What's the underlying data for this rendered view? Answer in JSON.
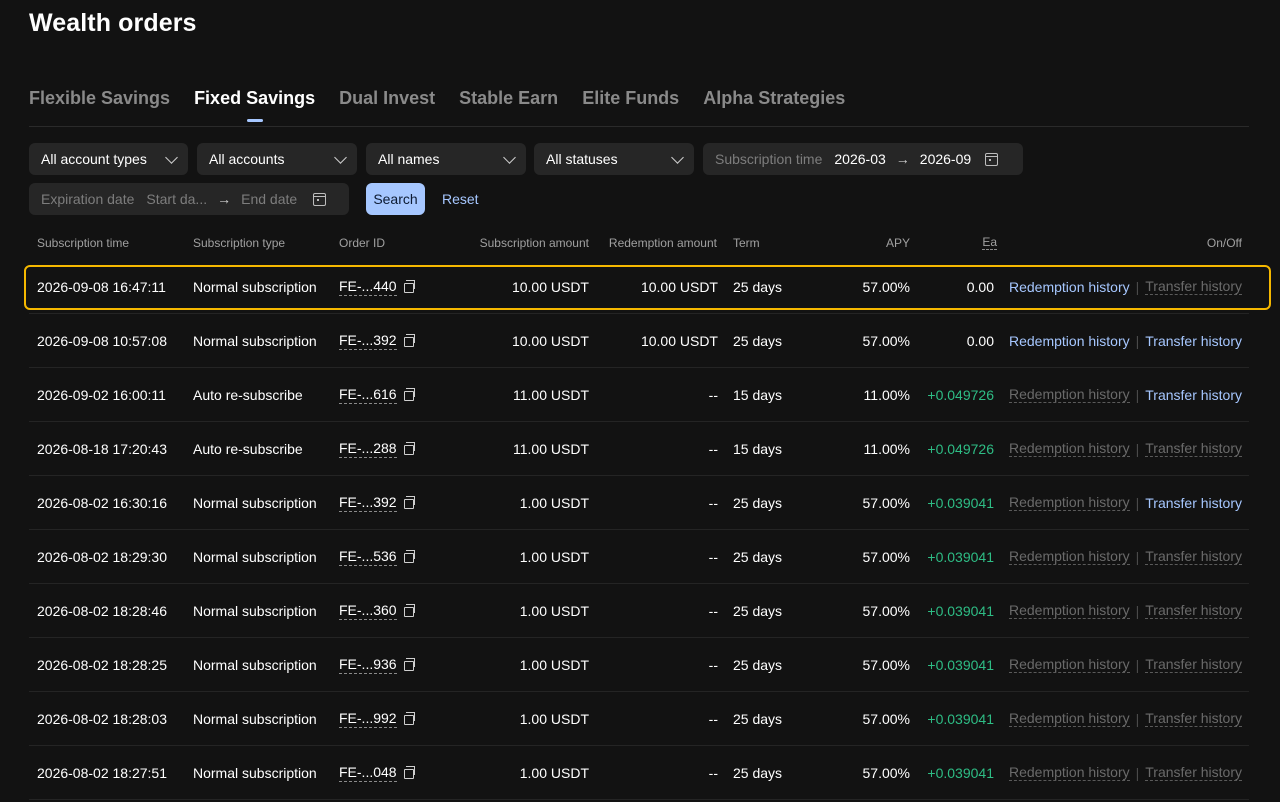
{
  "page": {
    "title": "Wealth orders"
  },
  "tabs": [
    "Flexible Savings",
    "Fixed Savings",
    "Dual Invest",
    "Stable Earn",
    "Elite Funds",
    "Alpha Strategies"
  ],
  "active_tab": "Fixed Savings",
  "filters": {
    "account_types": "All account types",
    "accounts": "All accounts",
    "names": "All names",
    "statuses": "All statuses",
    "subscription_time": {
      "label": "Subscription time",
      "start": "2026-03",
      "end": "2026-09"
    },
    "expiration_date": {
      "label": "Expiration date",
      "start_placeholder": "Start da...",
      "end_placeholder": "End date"
    },
    "search_label": "Search",
    "reset_label": "Reset"
  },
  "table": {
    "headers": {
      "subscription_time": "Subscription time",
      "subscription_type": "Subscription type",
      "order_id": "Order ID",
      "subscription_amount": "Subscription amount",
      "redemption_amount": "Redemption amount",
      "term": "Term",
      "apy": "APY",
      "earnings": "Ea",
      "on_off": "On/Off"
    },
    "rows": [
      {
        "time": "2026-09-08 16:47:11",
        "type": "Normal subscription",
        "order_id": "FE-...440",
        "sub_amount": "10.00 USDT",
        "red_amount": "10.00 USDT",
        "term": "25 days",
        "apy": "57.00%",
        "earnings": "0.00",
        "earnings_positive": false,
        "redemption_history": "Redemption history",
        "redemption_active": true,
        "transfer_history": "Transfer history",
        "transfer_active": false
      },
      {
        "time": "2026-09-08 10:57:08",
        "type": "Normal subscription",
        "order_id": "FE-...392",
        "sub_amount": "10.00 USDT",
        "red_amount": "10.00 USDT",
        "term": "25 days",
        "apy": "57.00%",
        "earnings": "0.00",
        "earnings_positive": false,
        "redemption_history": "Redemption history",
        "redemption_active": true,
        "transfer_history": "Transfer history",
        "transfer_active": true
      },
      {
        "time": "2026-09-02 16:00:11",
        "type": "Auto re-subscribe",
        "order_id": "FE-...616",
        "sub_amount": "11.00 USDT",
        "red_amount": "--",
        "term": "15 days",
        "apy": "11.00%",
        "earnings": "+0.049726",
        "earnings_positive": true,
        "redemption_history": "Redemption history",
        "redemption_active": false,
        "transfer_history": "Transfer history",
        "transfer_active": true
      },
      {
        "time": "2026-08-18 17:20:43",
        "type": "Auto re-subscribe",
        "order_id": "FE-...288",
        "sub_amount": "11.00 USDT",
        "red_amount": "--",
        "term": "15 days",
        "apy": "11.00%",
        "earnings": "+0.049726",
        "earnings_positive": true,
        "redemption_history": "Redemption history",
        "redemption_active": false,
        "transfer_history": "Transfer history",
        "transfer_active": false
      },
      {
        "time": "2026-08-02 16:30:16",
        "type": "Normal subscription",
        "order_id": "FE-...392",
        "sub_amount": "1.00 USDT",
        "red_amount": "--",
        "term": "25 days",
        "apy": "57.00%",
        "earnings": "+0.039041",
        "earnings_positive": true,
        "redemption_history": "Redemption history",
        "redemption_active": false,
        "transfer_history": "Transfer history",
        "transfer_active": true
      },
      {
        "time": "2026-08-02 18:29:30",
        "type": "Normal subscription",
        "order_id": "FE-...536",
        "sub_amount": "1.00 USDT",
        "red_amount": "--",
        "term": "25 days",
        "apy": "57.00%",
        "earnings": "+0.039041",
        "earnings_positive": true,
        "redemption_history": "Redemption history",
        "redemption_active": false,
        "transfer_history": "Transfer history",
        "transfer_active": false
      },
      {
        "time": "2026-08-02 18:28:46",
        "type": "Normal subscription",
        "order_id": "FE-...360",
        "sub_amount": "1.00 USDT",
        "red_amount": "--",
        "term": "25 days",
        "apy": "57.00%",
        "earnings": "+0.039041",
        "earnings_positive": true,
        "redemption_history": "Redemption history",
        "redemption_active": false,
        "transfer_history": "Transfer history",
        "transfer_active": false
      },
      {
        "time": "2026-08-02 18:28:25",
        "type": "Normal subscription",
        "order_id": "FE-...936",
        "sub_amount": "1.00 USDT",
        "red_amount": "--",
        "term": "25 days",
        "apy": "57.00%",
        "earnings": "+0.039041",
        "earnings_positive": true,
        "redemption_history": "Redemption history",
        "redemption_active": false,
        "transfer_history": "Transfer history",
        "transfer_active": false
      },
      {
        "time": "2026-08-02 18:28:03",
        "type": "Normal subscription",
        "order_id": "FE-...992",
        "sub_amount": "1.00 USDT",
        "red_amount": "--",
        "term": "25 days",
        "apy": "57.00%",
        "earnings": "+0.039041",
        "earnings_positive": true,
        "redemption_history": "Redemption history",
        "redemption_active": false,
        "transfer_history": "Transfer history",
        "transfer_active": false
      },
      {
        "time": "2026-08-02 18:27:51",
        "type": "Normal subscription",
        "order_id": "FE-...048",
        "sub_amount": "1.00 USDT",
        "red_amount": "--",
        "term": "25 days",
        "apy": "57.00%",
        "earnings": "+0.039041",
        "earnings_positive": true,
        "redemption_history": "Redemption history",
        "redemption_active": false,
        "transfer_history": "Transfer history",
        "transfer_active": false
      }
    ]
  },
  "colors": {
    "accent": "#a6c7ff",
    "positive": "#2ebd85",
    "highlight": "#f5b800",
    "background": "#121212"
  }
}
